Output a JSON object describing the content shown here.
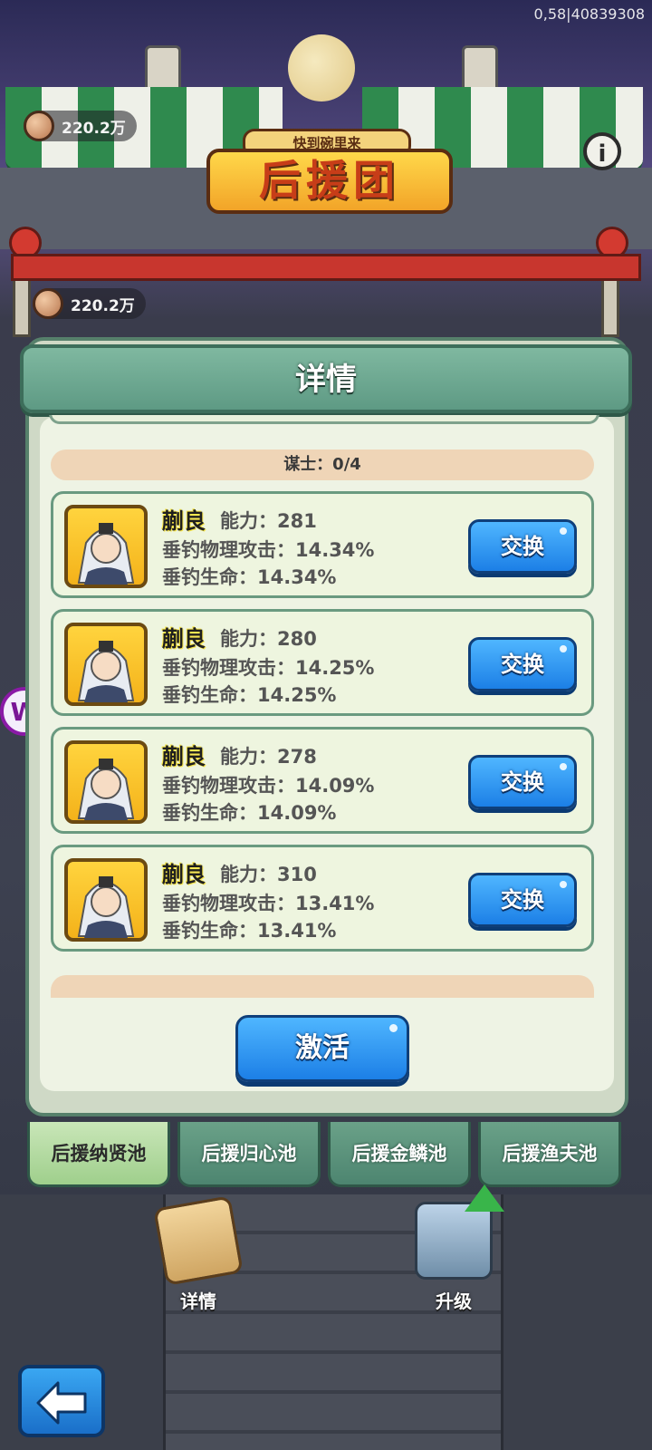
{
  "debug_text": "0,58|40839308",
  "header": {
    "sign_small": "快到碗里来",
    "sign_main": "后援团",
    "currency_top": "220.2万",
    "currency_second": "220.2万",
    "info_icon": "info-icon"
  },
  "panel": {
    "title": "详情",
    "section_label": "谋士：0/4",
    "cards": [
      {
        "name": "蒯良",
        "power": "能力：281",
        "atk": "垂钓物理攻击：14.34%",
        "hp": "垂钓生命：14.34%",
        "button": "交换"
      },
      {
        "name": "蒯良",
        "power": "能力：280",
        "atk": "垂钓物理攻击：14.25%",
        "hp": "垂钓生命：14.25%",
        "button": "交换"
      },
      {
        "name": "蒯良",
        "power": "能力：278",
        "atk": "垂钓物理攻击：14.09%",
        "hp": "垂钓生命：14.09%",
        "button": "交换"
      },
      {
        "name": "蒯良",
        "power": "能力：310",
        "atk": "垂钓物理攻击：13.41%",
        "hp": "垂钓生命：13.41%",
        "button": "交换"
      }
    ],
    "activate_button": "激活"
  },
  "tabs": [
    {
      "label": "后援纳贤池",
      "active": true
    },
    {
      "label": "后援归心池",
      "active": false
    },
    {
      "label": "后援金鳞池",
      "active": false
    },
    {
      "label": "后援渔夫池",
      "active": false
    }
  ],
  "bottom": {
    "details_label": "详情",
    "upgrade_label": "升级"
  },
  "side_logo": "W",
  "colors": {
    "panel_green": "#5e9a84",
    "button_blue": "#1c7fe6",
    "portrait_gold": "#f4b21a",
    "section_bar": "#efd5b7"
  }
}
